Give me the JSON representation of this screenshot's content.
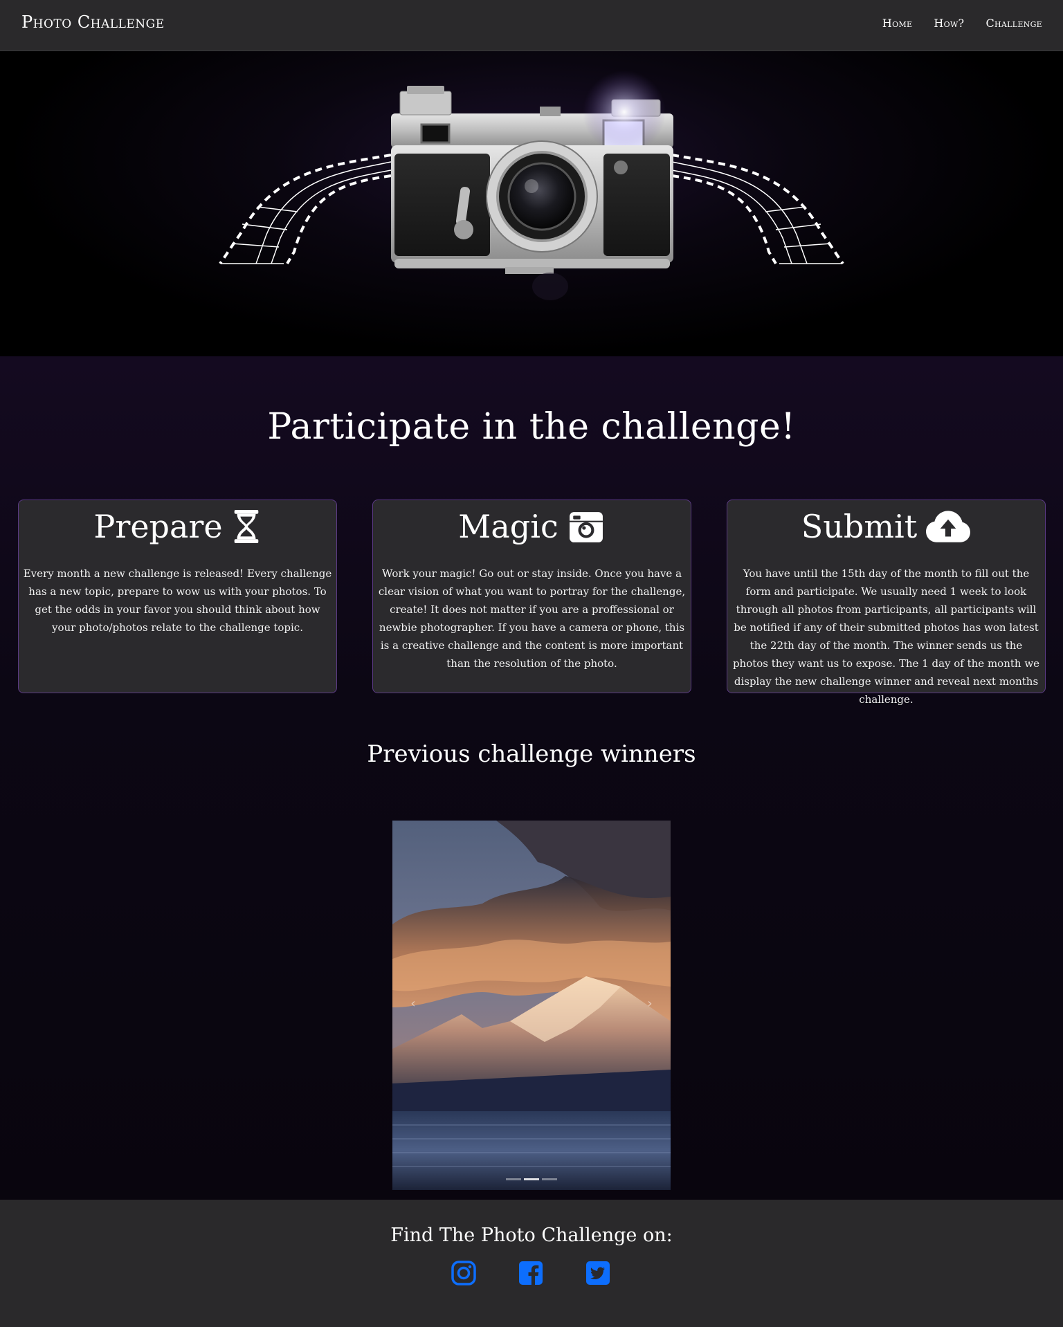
{
  "navbar": {
    "brand": "Photo Challenge",
    "links": [
      "Home",
      "How?",
      "Challenge"
    ]
  },
  "hero": {
    "image": "camera-with-film-strip"
  },
  "main": {
    "title": "Participate in the challenge!",
    "cards": [
      {
        "title": "Prepare",
        "icon": "hourglass-icon",
        "text": "Every month a new challenge is released! Every challenge has a new topic, prepare to wow us with your photos. To get the odds in your favor you should think about how your photo/photos relate to the challenge topic."
      },
      {
        "title": "Magic",
        "icon": "camera-retro-icon",
        "text": "Work your magic! Go out or stay inside. Once you have a clear vision of what you want to portray for the challenge, create! It does not matter if you are a proffessional or newbie photographer. If you have a camera or phone, this is a creative challenge and the content is more important than the resolution of the photo."
      },
      {
        "title": "Submit",
        "icon": "cloud-upload-icon",
        "text": "You have until the 15th day of the month to fill out the form and participate. We usually need 1 week to look through all photos from participants, all participants will be notified if any of their submitted photos has won latest the 22th day of the month. The winner sends us the photos they want us to expose. The 1 day of the month we display the new challenge winner and reveal next months challenge."
      }
    ],
    "winners_title": "Previous challenge winners",
    "carousel": {
      "prev_label": "‹",
      "next_label": "›",
      "slides": 3,
      "active": 1
    }
  },
  "footer": {
    "title": "Find The Photo Challenge on:",
    "social": [
      "instagram-icon",
      "facebook-icon",
      "twitter-icon"
    ],
    "icon_color": "#0d6efd"
  }
}
